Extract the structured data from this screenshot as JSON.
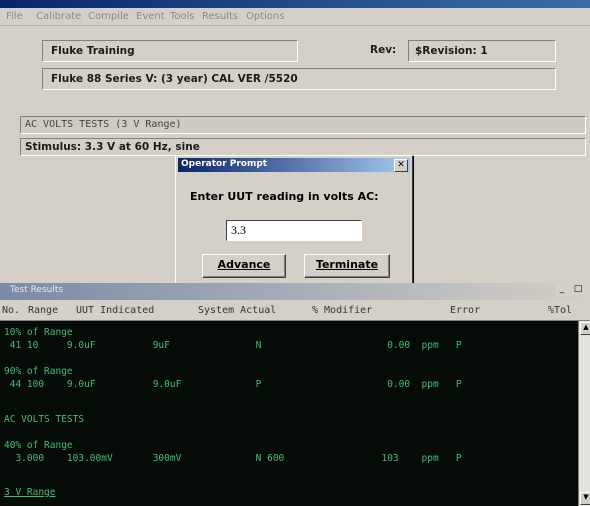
{
  "menu": [
    "File",
    "Calibrate",
    "Compile",
    "Event",
    "Tools",
    "Results",
    "Options"
  ],
  "procedure": {
    "title": "Fluke Training",
    "rev_label": "Rev:",
    "rev_value": "$Revision: 1",
    "subtitle": "Fluke 88 Series V: (3 year) CAL VER /5520"
  },
  "test_section": "AC VOLTS TESTS (3 V Range)",
  "stimulus": "Stimulus: 3.3 V at 60 Hz, sine",
  "dialog": {
    "title": "Operator Prompt",
    "prompt": "Enter UUT reading in volts AC:",
    "input_value": "3.3",
    "advance": "Advance",
    "terminate": "Terminate"
  },
  "results": {
    "window_title": "Test Results",
    "headers": [
      "No.",
      "Range",
      "UUT Indicated",
      "System Actual",
      "% Modifier",
      "Error",
      "%Tol"
    ],
    "lines": [
      "10% of Range",
      " 41 10     9.0uF          9uF               N                      0.00  ppm   P",
      "",
      "90% of Range",
      " 44 100    9.0uF          9.0uF             P                      0.00  ppm   P",
      "",
      "AC VOLTS TESTS",
      "",
      "40% of Range",
      "  3.000    103.00mV       300mV             N 600                 103    ppm   P",
      "",
      "3 V Range"
    ]
  }
}
